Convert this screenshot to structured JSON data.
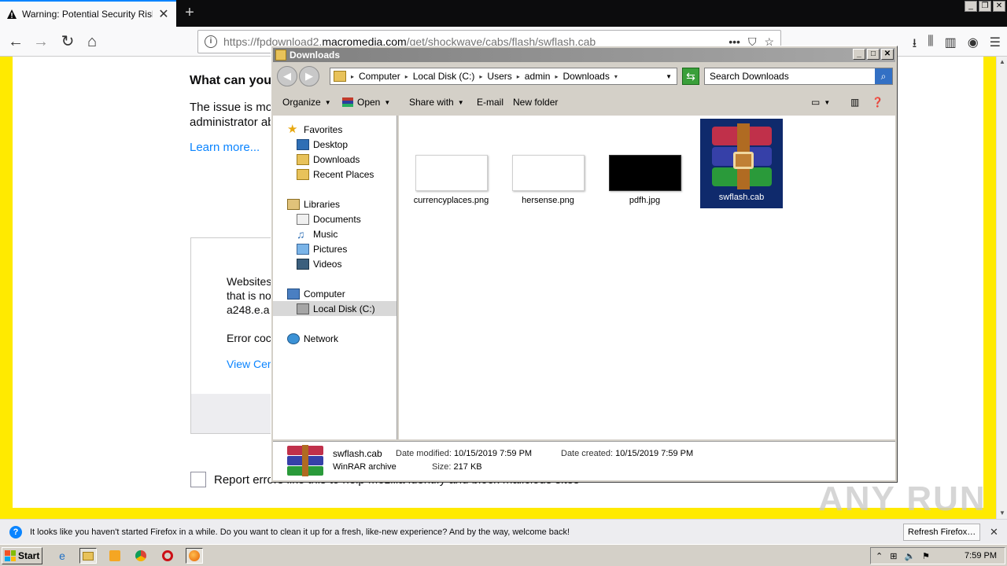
{
  "firefox": {
    "tab_title": "Warning: Potential Security Risk Ah",
    "url_prefix": "https://fpdownload2.",
    "url_domain": "macromedia.com",
    "url_path": "/get/shockwave/cabs/flash/swflash.cab",
    "url_more": "•••"
  },
  "error_page": {
    "heading": "What can you",
    "para": "The issue is mo administrator ab",
    "learn_more": "Learn more...",
    "adv_line1": "Websites",
    "adv_line2": "that is no",
    "adv_line3": "a248.e.a",
    "adv_error": "Error coc",
    "adv_view": "View Cer",
    "report_label": "Report errors like this to help Mozilla identify and block malicious sites"
  },
  "explorer": {
    "title": "Downloads",
    "breadcrumb": [
      "Computer",
      "Local Disk (C:)",
      "Users",
      "admin",
      "Downloads"
    ],
    "search_placeholder": "Search Downloads",
    "toolbar": {
      "organize": "Organize",
      "open": "Open",
      "share_with": "Share with",
      "email": "E-mail",
      "new_folder": "New folder"
    },
    "nav": {
      "favorites": "Favorites",
      "desktop": "Desktop",
      "downloads": "Downloads",
      "recent_places": "Recent Places",
      "libraries": "Libraries",
      "documents": "Documents",
      "music": "Music",
      "pictures": "Pictures",
      "videos": "Videos",
      "computer": "Computer",
      "local_disk": "Local Disk (C:)",
      "network": "Network"
    },
    "files": [
      {
        "name": "currencyplaces.png"
      },
      {
        "name": "hersense.png"
      },
      {
        "name": "pdfh.jpg"
      },
      {
        "name": "swflash.cab"
      }
    ],
    "details": {
      "name": "swflash.cab",
      "type": "WinRAR archive",
      "modified_label": "Date modified:",
      "modified_value": "10/15/2019 7:59 PM",
      "created_label": "Date created:",
      "created_value": "10/15/2019 7:59 PM",
      "size_label": "Size:",
      "size_value": "217 KB"
    }
  },
  "notification": {
    "message": "It looks like you haven't started Firefox in a while. Do you want to clean it up for a fresh, like-new experience? And by the way, welcome back!",
    "button": "Refresh Firefox…"
  },
  "taskbar": {
    "start": "Start",
    "clock": "7:59 PM"
  },
  "watermark": "ANY RUN"
}
